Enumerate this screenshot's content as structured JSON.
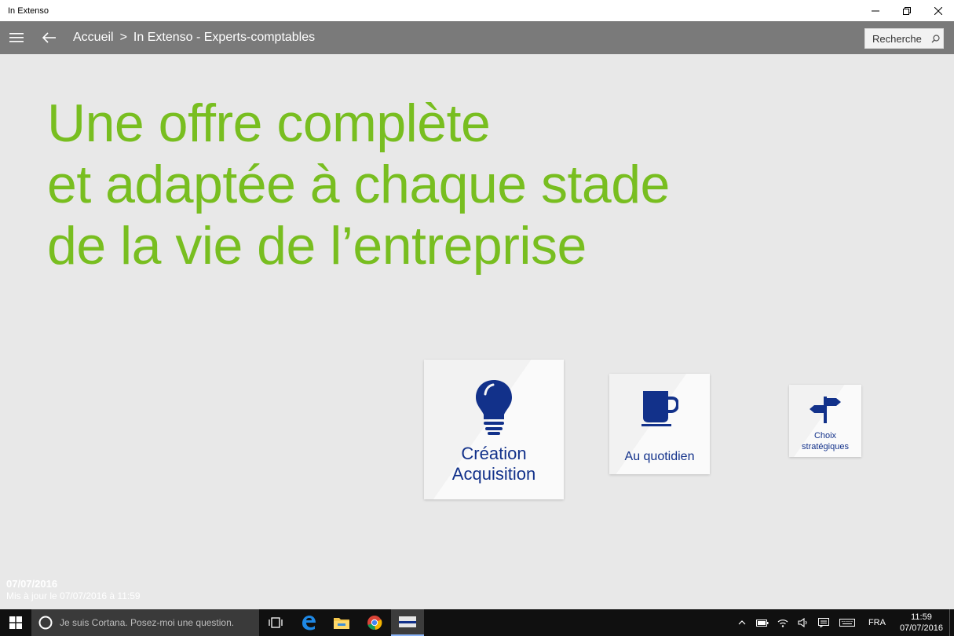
{
  "window": {
    "title": "In Extenso"
  },
  "appbar": {
    "breadcrumb_home": "Accueil",
    "breadcrumb_sep": ">",
    "breadcrumb_current": "In Extenso - Experts-comptables",
    "search_placeholder": "Recherche"
  },
  "headline": {
    "line1": "Une offre complète",
    "line2": "et adaptée à chaque stade",
    "line3": "de la vie de l’entreprise"
  },
  "tiles": [
    {
      "label_line1": "Création",
      "label_line2": "Acquisition",
      "icon": "lightbulb-icon"
    },
    {
      "label_line1": "Au quotidien",
      "icon": "cup-icon"
    },
    {
      "label_line1": "Choix",
      "label_line2": "stratégiques",
      "icon": "signpost-icon"
    }
  ],
  "update_info": {
    "date": "07/07/2016",
    "message": "Mis à jour le 07/07/2016 à 11:59"
  },
  "taskbar": {
    "cortana_placeholder": "Je suis Cortana. Posez-moi une question.",
    "language": "FRA",
    "time": "11:59",
    "date": "07/07/2016"
  },
  "colors": {
    "accent_green": "#78be20",
    "tile_blue": "#12318a",
    "appbar_gray": "#7a7a7a",
    "background": "#e8e8e8"
  }
}
